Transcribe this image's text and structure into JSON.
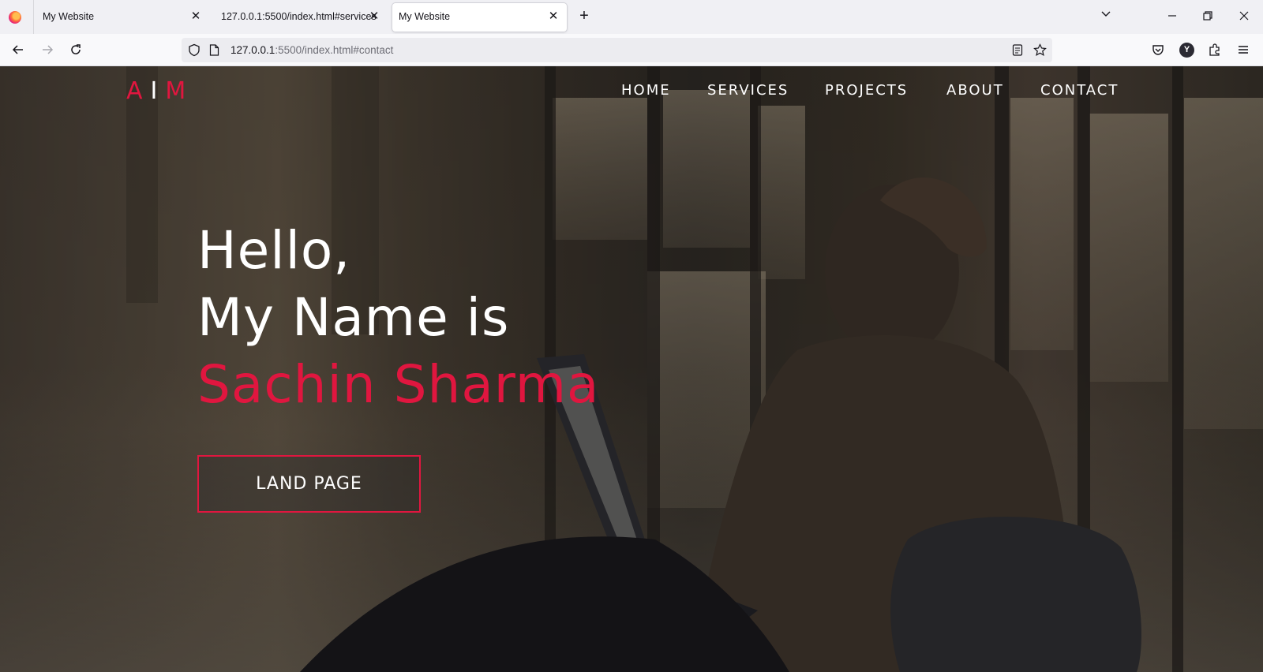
{
  "browser": {
    "tabs": [
      {
        "title": "My Website",
        "active": false
      },
      {
        "title": "127.0.0.1:5500/index.html#services",
        "active": false
      },
      {
        "title": "My Website",
        "active": true
      }
    ],
    "url": {
      "host": "127.0.0.1",
      "path": ":5500/index.html#contact"
    },
    "profile_initial": "Y"
  },
  "site": {
    "logo": {
      "left": "A",
      "bar": "I",
      "right": "M"
    },
    "nav": [
      "HOME",
      "SERVICES",
      "PROJECTS",
      "ABOUT",
      "CONTACT"
    ],
    "hero": {
      "line1": "Hello,",
      "line2": "My Name is",
      "name": "Sachin Sharma",
      "cta": "LAND PAGE"
    },
    "colors": {
      "accent": "#e0163f",
      "text": "#ffffff"
    }
  }
}
